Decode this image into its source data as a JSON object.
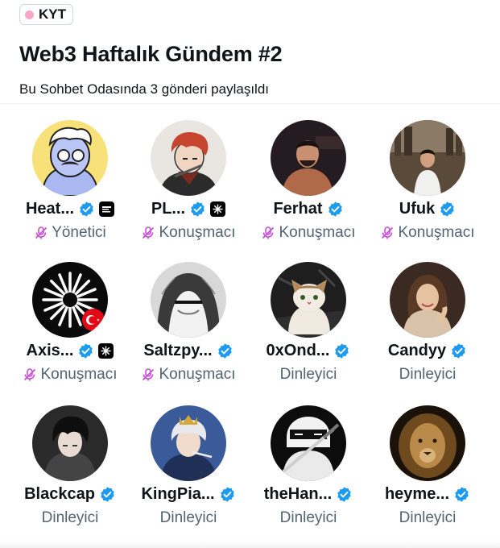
{
  "header": {
    "tag_label": "KYT",
    "title": "Web3 Haftalık Gündem #2",
    "subtitle": "Bu Sohbet Odasında 3 gönderi paylaşıldı"
  },
  "colors": {
    "verified": "#1d9bf0",
    "mic_muted": "#c84fd8",
    "role_text": "#536471",
    "tag_dot": "#f7a8c8"
  },
  "participants": [
    {
      "name": "Heat...",
      "role": "Yönetici",
      "verified": true,
      "affiliate": "badge-text-icon",
      "muted_mic": true,
      "avatar": "cartoon-mustache-avatar"
    },
    {
      "name": "PL...",
      "role": "Konuşmacı",
      "verified": true,
      "affiliate": "starburst-icon",
      "muted_mic": true,
      "avatar": "anime-redhair-avatar"
    },
    {
      "name": "Ferhat",
      "role": "Konuşmacı",
      "verified": true,
      "affiliate": "",
      "muted_mic": true,
      "avatar": "photo-man-avatar"
    },
    {
      "name": "Ufuk",
      "role": "Konuşmacı",
      "verified": true,
      "affiliate": "",
      "muted_mic": true,
      "avatar": "photo-city-avatar"
    },
    {
      "name": "Axis...",
      "role": "Konuşmacı",
      "verified": true,
      "affiliate": "starburst-icon",
      "muted_mic": true,
      "avatar": "starburst-flag-avatar"
    },
    {
      "name": "Saltzpy...",
      "role": "Konuşmacı",
      "verified": true,
      "affiliate": "",
      "muted_mic": true,
      "avatar": "hooded-figure-avatar"
    },
    {
      "name": "0xOnd...",
      "role": "Dinleyici",
      "verified": true,
      "affiliate": "",
      "muted_mic": false,
      "avatar": "cat-avatar"
    },
    {
      "name": "Candyy",
      "role": "Dinleyici",
      "verified": true,
      "affiliate": "",
      "muted_mic": false,
      "avatar": "woman-portrait-avatar"
    },
    {
      "name": "Blackcap",
      "role": "Dinleyici",
      "verified": true,
      "affiliate": "",
      "muted_mic": false,
      "avatar": "anime-darkhair-avatar"
    },
    {
      "name": "KingPia...",
      "role": "Dinleyici",
      "verified": true,
      "affiliate": "",
      "muted_mic": false,
      "avatar": "anime-crown-avatar"
    },
    {
      "name": "theHan...",
      "role": "Dinleyici",
      "verified": true,
      "affiliate": "",
      "muted_mic": false,
      "avatar": "ninja-avatar"
    },
    {
      "name": "heyme...",
      "role": "Dinleyici",
      "verified": true,
      "affiliate": "",
      "muted_mic": false,
      "avatar": "lion-avatar"
    }
  ]
}
